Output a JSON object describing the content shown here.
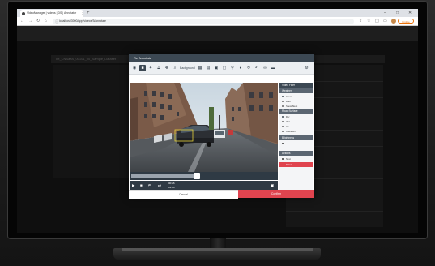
{
  "browser": {
    "tab_title": "VideoManager | videos | DS | Annotator",
    "url": "localhost/3000/app/videos/3/annotate",
    "update_label": "Update",
    "window_controls": [
      "–",
      "□",
      "✕"
    ]
  },
  "app_background": {
    "header_text": "IM_CNSaaS_00101_00_Sample_Dataset"
  },
  "modal": {
    "title": "Re Annotate",
    "toolbar": {
      "background_label": "Background"
    },
    "sidebar": {
      "video_filter_heading": "Video Filter",
      "weather": {
        "heading": "Weather",
        "options": [
          "Clear",
          "Rain",
          "Snow/Sleet"
        ]
      },
      "road_surface": {
        "heading": "Road Surface",
        "options": [
          "Dry",
          "Wet",
          "Icy",
          "Unknown"
        ]
      },
      "brightness_heading": "Brightness",
      "actions": {
        "heading": "Actions",
        "items": [
          "Next",
          "Delete"
        ]
      }
    },
    "playback": {
      "current_time": "00:26",
      "total_time": "01:04",
      "progress": 0.45
    },
    "footer": {
      "cancel_label": "Cancel",
      "confirm_label": "Confirm"
    }
  },
  "colors": {
    "modal_header": "#3c4853",
    "confirm": "#e0444f",
    "detection_box": "#e6d23a"
  }
}
